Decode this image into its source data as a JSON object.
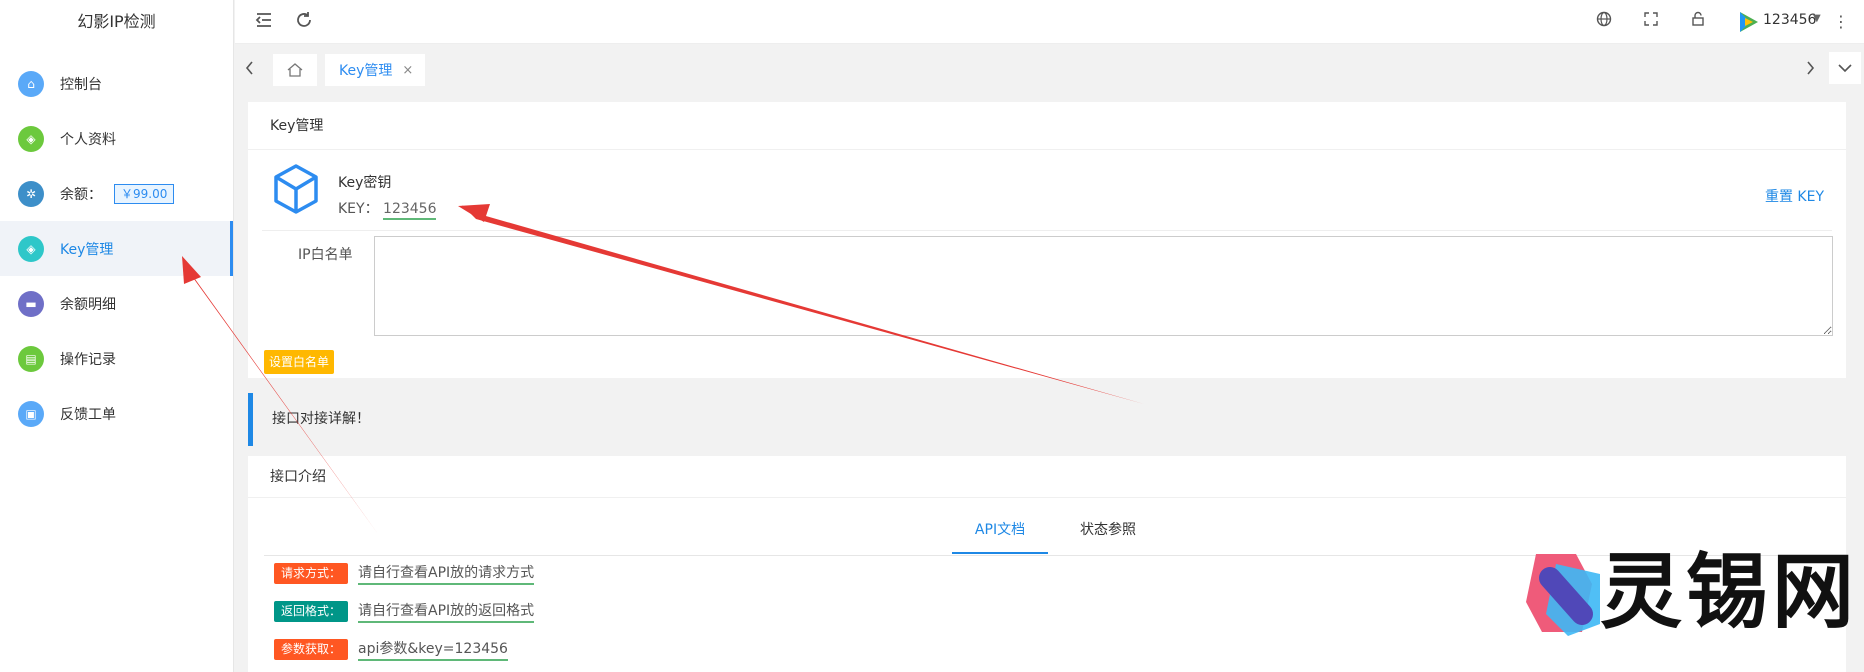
{
  "app": {
    "title": "幻影IP检测"
  },
  "sidebar": {
    "items": [
      {
        "label": "控制台",
        "color": "#5aa9f8",
        "glyph": "⌂"
      },
      {
        "label": "个人资料",
        "color": "#6cc93d",
        "glyph": "◈"
      },
      {
        "label": "余额：",
        "color": "#3d8fc9",
        "glyph": "✲",
        "badge": "￥99.00"
      },
      {
        "label": "Key管理",
        "color": "#2ec7c9",
        "glyph": "◈",
        "active": true
      },
      {
        "label": "余额明细",
        "color": "#6f6fc7",
        "glyph": "▬"
      },
      {
        "label": "操作记录",
        "color": "#6cc93d",
        "glyph": "▤"
      },
      {
        "label": "反馈工单",
        "color": "#5aa9f8",
        "glyph": "▣"
      }
    ]
  },
  "header": {
    "user_name": "123456",
    "icons": [
      "menu-fold-icon",
      "refresh-icon",
      "globe-icon",
      "fullscreen-icon",
      "lock-icon",
      "more-icon"
    ]
  },
  "tabs": {
    "current": "Key管理",
    "close": "×"
  },
  "key_panel": {
    "title": "Key管理",
    "key_title": "Key密钥",
    "key_prefix": "KEY：",
    "key_value": "123456",
    "reset_label": "重置 KEY",
    "ip_label": "IP白名单",
    "ip_value": "",
    "set_button": "设置白名单"
  },
  "notice": {
    "text": "接口对接详解！"
  },
  "doc_panel": {
    "title": "接口介绍",
    "tabs": [
      "API文档",
      "状态参照"
    ],
    "rows": [
      {
        "tag": "请求方式：",
        "tag_color": "#ff5722",
        "text": "请自行查看API放的请求方式"
      },
      {
        "tag": "返回格式：",
        "tag_color": "#009688",
        "text": "请自行查看API放的返回格式"
      },
      {
        "tag": "参数获取：",
        "tag_color": "#ff5722",
        "text": "api参数&key=123456"
      }
    ]
  },
  "watermark": {
    "text": "灵锡网"
  },
  "colors": {
    "accent": "#1e88e5",
    "arrow": "#e53935",
    "warn_button": "#ffb800"
  }
}
